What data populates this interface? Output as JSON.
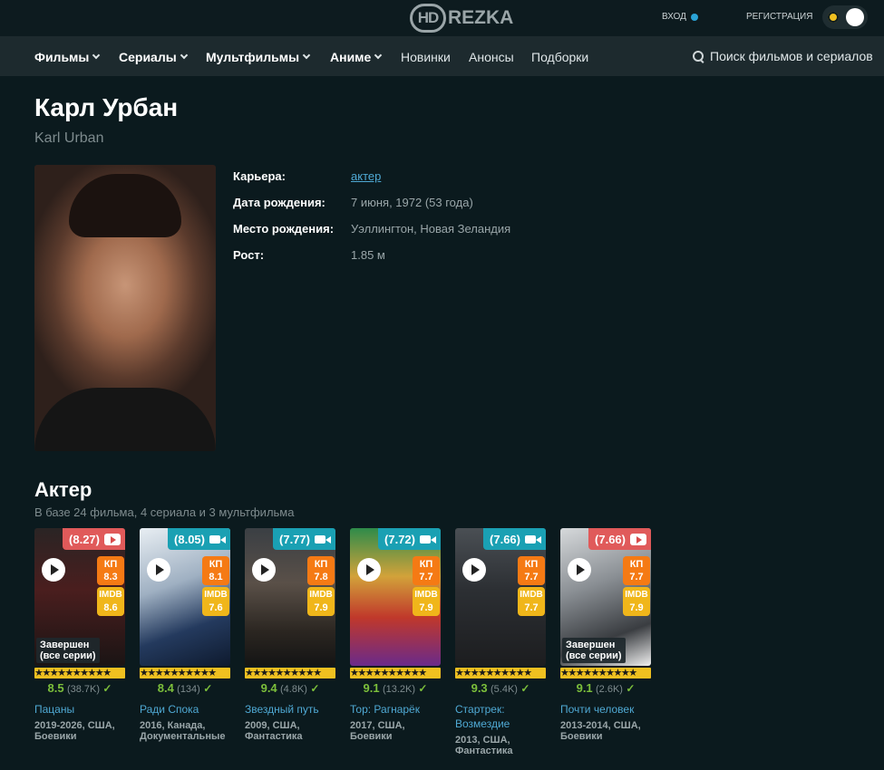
{
  "header": {
    "logo_hd": "HD",
    "logo_rezka": "REZKA",
    "login": "ВХОД",
    "register": "РЕГИСТРАЦИЯ"
  },
  "nav": {
    "items": [
      {
        "label": "Фильмы",
        "dropdown": true
      },
      {
        "label": "Сериалы",
        "dropdown": true
      },
      {
        "label": "Мультфильмы",
        "dropdown": true
      },
      {
        "label": "Аниме",
        "dropdown": true
      },
      {
        "label": "Новинки",
        "dropdown": false
      },
      {
        "label": "Анонсы",
        "dropdown": false
      },
      {
        "label": "Подборки",
        "dropdown": false
      }
    ],
    "search_placeholder": "Поиск фильмов и сериалов"
  },
  "person": {
    "name": "Карл Урбан",
    "original_name": "Karl Urban",
    "info": [
      {
        "label": "Карьера:",
        "value": "актер",
        "link": true
      },
      {
        "label": "Дата рождения:",
        "value": "7 июня, 1972 (53 года)",
        "link": false
      },
      {
        "label": "Место рождения:",
        "value": "Уэллингтон, Новая Зеландия",
        "link": false
      },
      {
        "label": "Рост:",
        "value": "1.85 м",
        "link": false
      }
    ]
  },
  "section": {
    "title": "Актер",
    "subtitle": "В базе 24 фильма, 4 сериала и 3 мультфильма"
  },
  "colors": {
    "badge_red": "#e05a5a",
    "badge_teal": "#1aa0b3",
    "kp": "#f57a14",
    "imdb": "#f0b61a",
    "link": "#4fa9d4",
    "score_green": "#7cbf3b"
  },
  "cards": [
    {
      "rating": "(8.27)",
      "badge_color": "red",
      "icon": "youtube-icon",
      "kp_label": "КП",
      "kp": "8.3",
      "imdb_label": "IMDB",
      "imdb": "8.6",
      "status": "Завершен\n(все серии)",
      "score": "8.5",
      "votes": "(38.7K)",
      "check": "✓",
      "title": "Пацаны",
      "meta": "2019-2026, США, Боевики",
      "poster": "linear-gradient(180deg,#2a2424 0%,#4a1e1e 45%,#1a1414 100%)"
    },
    {
      "rating": "(8.05)",
      "badge_color": "teal",
      "icon": "camera-icon",
      "kp_label": "КП",
      "kp": "8.1",
      "imdb_label": "IMDB",
      "imdb": "7.6",
      "status": "",
      "score": "8.4",
      "votes": "(134)",
      "check": "✓",
      "title": "Ради Спока",
      "meta": "2016, Канада, Документальные",
      "poster": "linear-gradient(160deg,#e8eef3 0%,#9fb0c2 40%,#243a5e 70%,#0e1a2e 100%)"
    },
    {
      "rating": "(7.77)",
      "badge_color": "teal",
      "icon": "camera-icon",
      "kp_label": "КП",
      "kp": "7.8",
      "imdb_label": "IMDB",
      "imdb": "7.9",
      "status": "",
      "score": "9.4",
      "votes": "(4.8K)",
      "check": "✓",
      "title": "Звездный путь",
      "meta": "2009, США, Фантастика",
      "poster": "linear-gradient(180deg,#3a3f44 0%,#5a5048 40%,#2b2621 75%,#141414 100%)"
    },
    {
      "rating": "(7.72)",
      "badge_color": "teal",
      "icon": "camera-icon",
      "kp_label": "КП",
      "kp": "7.7",
      "imdb_label": "IMDB",
      "imdb": "7.9",
      "status": "",
      "score": "9.1",
      "votes": "(13.2K)",
      "check": "✓",
      "title": "Тор: Рагнарёк",
      "meta": "2017, США, Боевики",
      "poster": "linear-gradient(180deg,#2e8b4a 0%,#d2a23a 35%,#c0382b 65%,#6a2a8a 100%)"
    },
    {
      "rating": "(7.66)",
      "badge_color": "teal",
      "icon": "camera-icon",
      "kp_label": "КП",
      "kp": "7.7",
      "imdb_label": "IMDB",
      "imdb": "7.7",
      "status": "",
      "score": "9.3",
      "votes": "(5.4K)",
      "check": "✓",
      "title": "Стартрек: Возмездие",
      "meta": "2013, США, Фантастика",
      "poster": "linear-gradient(180deg,#4a4f54 0%,#2c2f33 45%,#1c1d1f 100%)"
    },
    {
      "rating": "(7.66)",
      "badge_color": "red",
      "icon": "youtube-icon",
      "kp_label": "КП",
      "kp": "7.7",
      "imdb_label": "IMDB",
      "imdb": "7.9",
      "status": "Завершен\n(все серии)",
      "score": "9.1",
      "votes": "(2.6K)",
      "check": "✓",
      "title": "Почти человек",
      "meta": "2013-2014, США, Боевики",
      "poster": "linear-gradient(160deg,#d6d9db 0%,#8a8f94 40%,#3a3d41 75%,#f0f0f0 100%)"
    }
  ]
}
